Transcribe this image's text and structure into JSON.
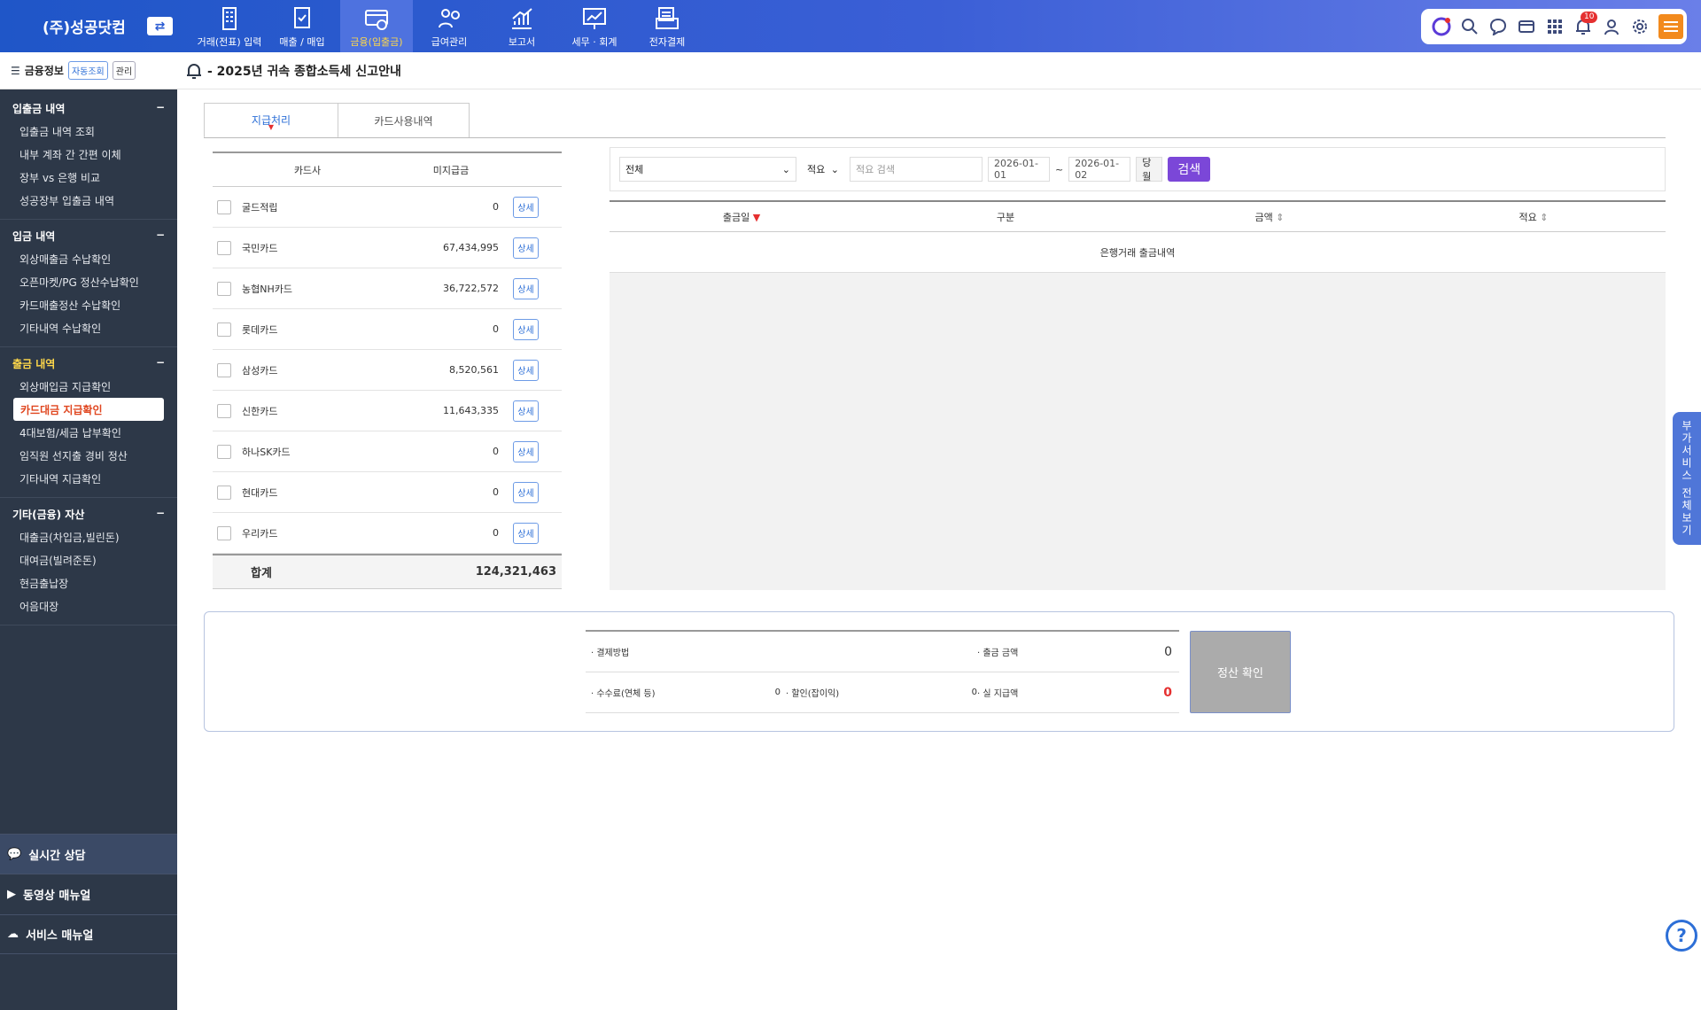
{
  "header": {
    "company": "(주)성공닷컴",
    "menus": [
      {
        "label": "거래(전표) 입력",
        "icon": "building-icon"
      },
      {
        "label": "매출 / 매입",
        "icon": "receipt-icon"
      },
      {
        "label": "금융(입출금)",
        "icon": "card-money-icon",
        "active": true
      },
      {
        "label": "급여관리",
        "icon": "people-coin-icon"
      },
      {
        "label": "보고서",
        "icon": "chart-up-icon"
      },
      {
        "label": "세무 · 회계",
        "icon": "board-chart-icon"
      },
      {
        "label": "전자결제",
        "icon": "document-stack-icon"
      }
    ],
    "notification_count": "10"
  },
  "sidebar": {
    "title": "금융정보",
    "auto_label": "자동조회",
    "manage_label": "관리",
    "sections": [
      {
        "title": "입출금 내역",
        "items": [
          "입출금 내역 조회",
          "내부 계좌 간 간편 이체",
          "장부 vs 은행 비교",
          "성공장부 입출금 내역"
        ]
      },
      {
        "title": "입금 내역",
        "items": [
          "외상매출금 수납확인",
          "오픈마켓/PG 정산수납확인",
          "카드매출정산 수납확인",
          "기타내역 수납확인"
        ]
      },
      {
        "title": "출금 내역",
        "items": [
          "외상매입금 지급확인",
          "카드대금 지급확인",
          "4대보험/세금 납부확인",
          "임직원 선지출 경비 정산",
          "기타내역 지급확인"
        ]
      },
      {
        "title": "기타(금융) 자산",
        "items": [
          "대출금(차입금,빌린돈)",
          "대여금(빌려준돈)",
          "현금출납장",
          "어음대장"
        ]
      }
    ],
    "bottom": [
      "실시간 상담",
      "동영상 매뉴얼",
      "서비스 매뉴얼"
    ]
  },
  "notice": "- 2025년 귀속 종합소득세 신고안내",
  "tabs": [
    "지급처리",
    "카드사용내역"
  ],
  "card_table": {
    "headers": [
      "카드사",
      "미지급금"
    ],
    "detail_label": "상세",
    "rows": [
      {
        "name": "굴드적립",
        "amount": "0"
      },
      {
        "name": "국민카드",
        "amount": "67,434,995"
      },
      {
        "name": "농협NH카드",
        "amount": "36,722,572"
      },
      {
        "name": "롯데카드",
        "amount": "0"
      },
      {
        "name": "삼성카드",
        "amount": "8,520,561"
      },
      {
        "name": "신한카드",
        "amount": "11,643,335"
      },
      {
        "name": "하나SK카드",
        "amount": "0"
      },
      {
        "name": "현대카드",
        "amount": "0"
      },
      {
        "name": "우리카드",
        "amount": "0"
      }
    ],
    "total_label": "합계",
    "total": "124,321,463"
  },
  "search": {
    "type_value": "전체",
    "field_value": "적요",
    "keyword_placeholder": "적요 검색",
    "date_from": "2026-01-01",
    "date_sep": "~",
    "date_to": "2026-01-02",
    "today_label": "당월",
    "button": "검색"
  },
  "grid": {
    "headers": [
      "출금일",
      "구분",
      "금액",
      "적요"
    ],
    "empty_text": "은행거래 출금내역"
  },
  "settlement": {
    "method_label": "· 결제방법",
    "out_amount_label": "· 출금 금액",
    "out_amount": "0",
    "fee_label": "· 수수료(연체 등)",
    "fee": "0",
    "discount_label": "· 할인(잡이익)",
    "discount": "0",
    "actual_label": "· 실 지급액",
    "actual": "0",
    "confirm_button": "정산 확인"
  },
  "side_tab": "부가서비스 전체보기",
  "colors": {
    "brand": "#1f56c8",
    "accent_purple": "#7b47d8",
    "active_yellow": "#ffd84a",
    "alert_red": "#e53030"
  }
}
